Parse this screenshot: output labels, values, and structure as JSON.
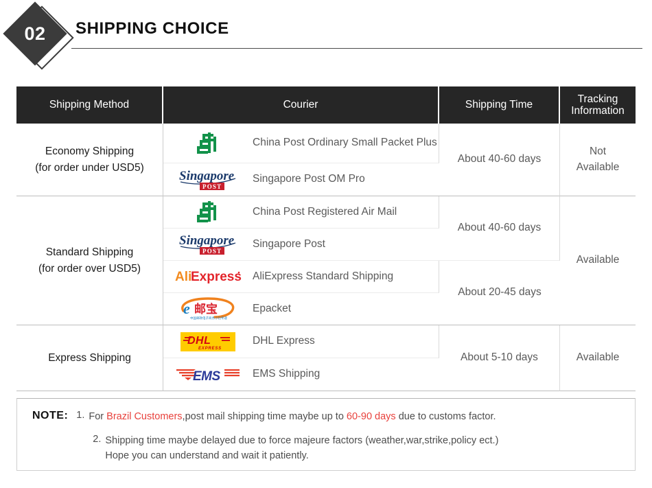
{
  "section": {
    "number": "02",
    "title": "SHIPPING CHOICE"
  },
  "table": {
    "headers": {
      "method": "Shipping Method",
      "courier": "Courier",
      "time": "Shipping Time",
      "tracking_line1": "Tracking",
      "tracking_line2": "Information"
    },
    "groups": [
      {
        "method_line1": "Economy Shipping",
        "method_line2": "(for order under USD5)",
        "tracking_line1": "Not",
        "tracking_line2": "Available",
        "couriers": [
          {
            "logo": "china-post-logo",
            "name": "China Post Ordinary Small Packet Plus"
          },
          {
            "logo": "singapore-post-logo",
            "name": "Singapore Post OM Pro"
          }
        ],
        "times": [
          {
            "label": "About 40-60 days",
            "span": 2
          }
        ]
      },
      {
        "method_line1": "Standard Shipping",
        "method_line2": "(for order over USD5)",
        "tracking_line1": "Available",
        "tracking_line2": "",
        "couriers": [
          {
            "logo": "china-post-logo",
            "name": "China Post Registered Air Mail"
          },
          {
            "logo": "singapore-post-logo",
            "name": "Singapore Post"
          },
          {
            "logo": "aliexpress-logo",
            "name": "AliExpress Standard Shipping"
          },
          {
            "logo": "epacket-logo",
            "name": "Epacket"
          }
        ],
        "times": [
          {
            "label": "About 40-60 days",
            "span": 2
          },
          {
            "label": "About 20-45 days",
            "span": 2
          }
        ]
      },
      {
        "method_line1": "Express Shipping",
        "method_line2": "",
        "tracking_line1": "Available",
        "tracking_line2": "",
        "couriers": [
          {
            "logo": "dhl-logo",
            "name": "DHL Express"
          },
          {
            "logo": "ems-logo",
            "name": "EMS Shipping"
          }
        ],
        "times": [
          {
            "label": "About 5-10 days",
            "span": 2
          }
        ]
      }
    ]
  },
  "note": {
    "label": "NOTE:",
    "items": [
      {
        "number": "1.",
        "part1": "For ",
        "highlight1": "Brazil Customers",
        "part2": ",post mail shipping time maybe up to ",
        "highlight2": "60-90 days",
        "part3": " due to customs factor."
      },
      {
        "number": "2.",
        "line1": "Shipping time maybe delayed due to force majeure factors (weather,war,strike,policy ect.)",
        "line2": "Hope you can understand and wait it patiently."
      }
    ]
  },
  "colors": {
    "header_bg": "#262626",
    "accent_red": "#e8413c",
    "china_post_green": "#12924a",
    "singapore_navy": "#1b3a6b",
    "singapore_red": "#c8202e",
    "aliexpress_orange": "#f28b20",
    "aliexpress_red": "#e3242b",
    "dhl_yellow": "#ffcc00",
    "dhl_red": "#d40511",
    "ems_blue": "#2b3a99",
    "ems_red": "#e8402a",
    "epacket_orange": "#f0821e",
    "epacket_blue": "#1a7fc1",
    "epacket_red": "#d9232e"
  }
}
